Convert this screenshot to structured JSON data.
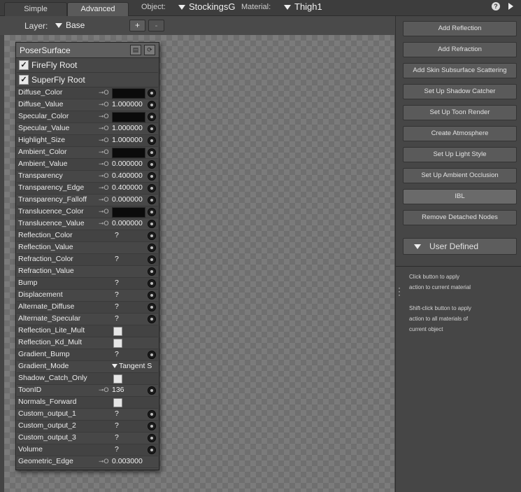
{
  "tabs": [
    {
      "label": "Simple"
    },
    {
      "label": "Advanced"
    }
  ],
  "object": {
    "label": "Object:",
    "value": "StockingsG"
  },
  "material": {
    "label": "Material:",
    "value": "Thigh1"
  },
  "help": "?",
  "layer": {
    "label": "Layer:",
    "value": "Base",
    "add_label": "+",
    "remove_label": "-"
  },
  "node": {
    "title": "PoserSurface",
    "roots": [
      {
        "label": "FireFly Root",
        "checked": true
      },
      {
        "label": "SuperFly Root",
        "checked": true
      }
    ],
    "key_icon": "⊸O",
    "params": [
      {
        "name": "Diffuse_Color",
        "key": true,
        "kind": "color",
        "value": "",
        "socket": true
      },
      {
        "name": "Diffuse_Value",
        "key": true,
        "kind": "num",
        "value": "1.000000",
        "socket": true
      },
      {
        "name": "Specular_Color",
        "key": true,
        "kind": "color",
        "value": "",
        "socket": true
      },
      {
        "name": "Specular_Value",
        "key": true,
        "kind": "num",
        "value": "1.000000",
        "socket": true
      },
      {
        "name": "Highlight_Size",
        "key": true,
        "kind": "num",
        "value": "1.000000",
        "socket": true
      },
      {
        "name": "Ambient_Color",
        "key": true,
        "kind": "color",
        "value": "",
        "socket": true
      },
      {
        "name": "Ambient_Value",
        "key": true,
        "kind": "num",
        "value": "0.000000",
        "socket": true
      },
      {
        "name": "Transparency",
        "key": true,
        "kind": "num",
        "value": "0.400000",
        "socket": true
      },
      {
        "name": "Transparency_Edge",
        "key": true,
        "kind": "num",
        "value": "0.400000",
        "socket": true
      },
      {
        "name": "Transparency_Falloff",
        "key": true,
        "kind": "num",
        "value": "0.000000",
        "socket": true
      },
      {
        "name": "Translucence_Color",
        "key": true,
        "kind": "color",
        "value": "",
        "socket": true
      },
      {
        "name": "Translucence_Value",
        "key": true,
        "kind": "num",
        "value": "0.000000",
        "socket": true
      },
      {
        "name": "Reflection_Color",
        "key": false,
        "kind": "q",
        "value": "?",
        "socket": true
      },
      {
        "name": "Reflection_Value",
        "key": false,
        "kind": "none",
        "value": "",
        "socket": true
      },
      {
        "name": "Refraction_Color",
        "key": false,
        "kind": "q",
        "value": "?",
        "socket": true
      },
      {
        "name": "Refraction_Value",
        "key": false,
        "kind": "none",
        "value": "",
        "socket": true
      },
      {
        "name": "Bump",
        "key": false,
        "kind": "q",
        "value": "?",
        "socket": true
      },
      {
        "name": "Displacement",
        "key": false,
        "kind": "q",
        "value": "?",
        "socket": true
      },
      {
        "name": "Alternate_Diffuse",
        "key": false,
        "kind": "q",
        "value": "?",
        "socket": true
      },
      {
        "name": "Alternate_Specular",
        "key": false,
        "kind": "q",
        "value": "?",
        "socket": true
      },
      {
        "name": "Reflection_Lite_Mult",
        "key": false,
        "kind": "check",
        "value": "",
        "socket": false
      },
      {
        "name": "Reflection_Kd_Mult",
        "key": false,
        "kind": "check",
        "value": "",
        "socket": false
      },
      {
        "name": "Gradient_Bump",
        "key": false,
        "kind": "q",
        "value": "?",
        "socket": true
      },
      {
        "name": "Gradient_Mode",
        "key": false,
        "kind": "select",
        "value": "Tangent S",
        "socket": false
      },
      {
        "name": "Shadow_Catch_Only",
        "key": false,
        "kind": "check",
        "value": "",
        "socket": false
      },
      {
        "name": "ToonID",
        "key": true,
        "kind": "num",
        "value": "136",
        "socket": true
      },
      {
        "name": "Normals_Forward",
        "key": false,
        "kind": "check",
        "value": "",
        "socket": false
      },
      {
        "name": "Custom_output_1",
        "key": false,
        "kind": "q",
        "value": "?",
        "socket": true
      },
      {
        "name": "Custom_output_2",
        "key": false,
        "kind": "q",
        "value": "?",
        "socket": true
      },
      {
        "name": "Custom_output_3",
        "key": false,
        "kind": "q",
        "value": "?",
        "socket": true
      },
      {
        "name": "Volume",
        "key": false,
        "kind": "q",
        "value": "?",
        "socket": true
      },
      {
        "name": "Geometric_Edge",
        "key": true,
        "kind": "num",
        "value": "0.003000",
        "socket": false
      }
    ]
  },
  "sidebar": {
    "buttons": [
      {
        "label": "Add Reflection"
      },
      {
        "label": "Add Refraction"
      },
      {
        "label": "Add Skin Subsurface Scattering"
      },
      {
        "label": "Set Up Shadow Catcher"
      },
      {
        "label": "Set Up Toon Render"
      },
      {
        "label": "Create Atmosphere"
      },
      {
        "label": "Set Up Light Style"
      },
      {
        "label": "Set Up Ambient Occlusion"
      },
      {
        "label": "IBL"
      },
      {
        "label": "Remove Detached Nodes"
      }
    ],
    "user_defined": "User Defined",
    "notes": [
      {
        "line1": "Click button to apply",
        "line2": "action to current material",
        "line3": ""
      },
      {
        "line1": "Shift-click button to apply",
        "line2": "action to all materials of",
        "line3": "current object"
      }
    ]
  }
}
